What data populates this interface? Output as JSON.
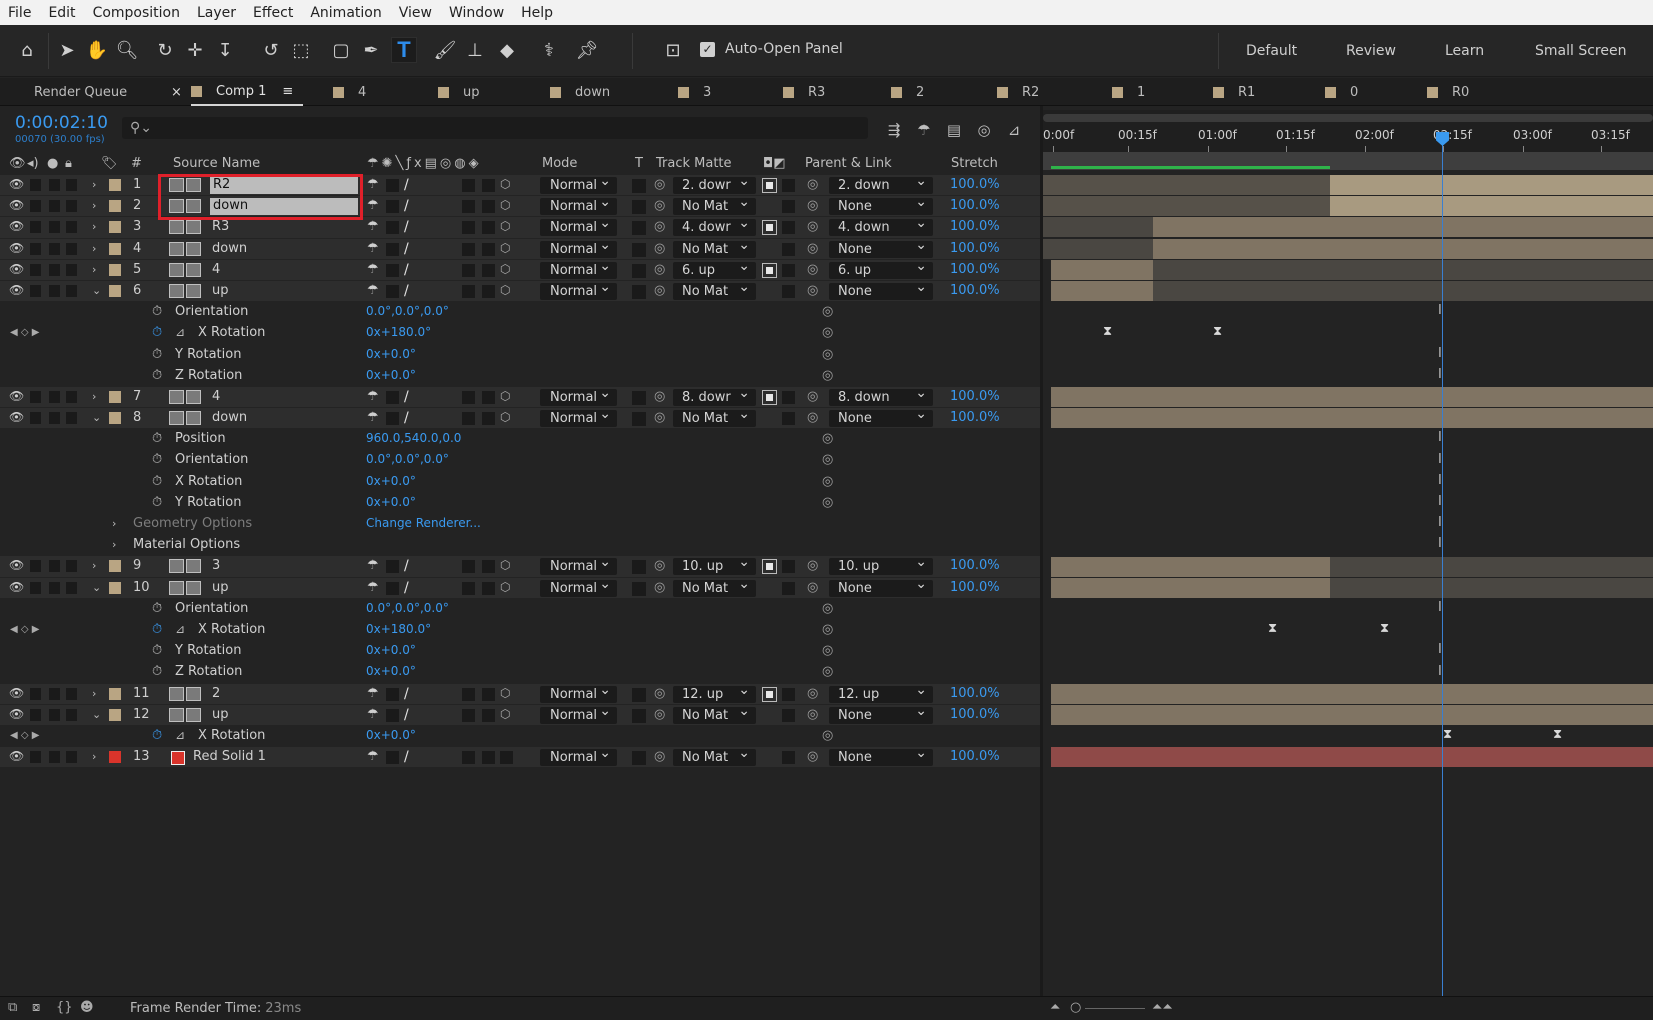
{
  "menu": [
    "File",
    "Edit",
    "Composition",
    "Layer",
    "Effect",
    "Animation",
    "View",
    "Window",
    "Help"
  ],
  "toolbar": {
    "auto_open_label": "Auto-Open Panel",
    "workspaces": [
      "Default",
      "Review",
      "Learn",
      "Small Screen"
    ]
  },
  "tabs": [
    "Render Queue",
    "Comp 1",
    "4",
    "up",
    "down",
    "3",
    "R3",
    "2",
    "R2",
    "1",
    "R1",
    "0",
    "R0"
  ],
  "timecode": "0:00:02:10",
  "frames": "00070 (30.00 fps)",
  "columns": {
    "num": "#",
    "source": "Source Name",
    "mode": "Mode",
    "t": "T",
    "track_matte": "Track Matte",
    "parent": "Parent & Link",
    "stretch": "Stretch"
  },
  "ruler_ticks": [
    "0:00f",
    "00:15f",
    "01:00f",
    "01:15f",
    "02:00f",
    "02:15f",
    "03:00f",
    "03:15f"
  ],
  "layers": [
    {
      "kind": "layer",
      "num": "1",
      "name": "R2",
      "expanded": false,
      "mode": "Normal",
      "matte": "2. dowr",
      "parent": "2. down",
      "stretch": "100.0%",
      "mattesq": true
    },
    {
      "kind": "layer",
      "num": "2",
      "name": "down",
      "expanded": false,
      "mode": "Normal",
      "matte": "No Mat",
      "parent": "None",
      "stretch": "100.0%",
      "mattesq": false
    },
    {
      "kind": "layer",
      "num": "3",
      "name": "R3",
      "expanded": false,
      "mode": "Normal",
      "matte": "4. dowr",
      "parent": "4. down",
      "stretch": "100.0%",
      "mattesq": true
    },
    {
      "kind": "layer",
      "num": "4",
      "name": "down",
      "expanded": false,
      "mode": "Normal",
      "matte": "No Mat",
      "parent": "None",
      "stretch": "100.0%",
      "mattesq": false
    },
    {
      "kind": "layer",
      "num": "5",
      "name": "4",
      "expanded": false,
      "mode": "Normal",
      "matte": "6. up",
      "parent": "6. up",
      "stretch": "100.0%",
      "mattesq": true
    },
    {
      "kind": "layer",
      "num": "6",
      "name": "up",
      "expanded": true,
      "mode": "Normal",
      "matte": "No Mat",
      "parent": "None",
      "stretch": "100.0%",
      "mattesq": false
    },
    {
      "kind": "prop",
      "name": "Orientation",
      "value": "0.0°,0.0°,0.0°",
      "active": false
    },
    {
      "kind": "prop",
      "name": "X Rotation",
      "value": "0x+180.0°",
      "active": true
    },
    {
      "kind": "prop",
      "name": "Y Rotation",
      "value": "0x+0.0°",
      "active": false
    },
    {
      "kind": "prop",
      "name": "Z Rotation",
      "value": "0x+0.0°",
      "active": false
    },
    {
      "kind": "layer",
      "num": "7",
      "name": "4",
      "expanded": false,
      "mode": "Normal",
      "matte": "8. dowr",
      "parent": "8. down",
      "stretch": "100.0%",
      "mattesq": true
    },
    {
      "kind": "layer",
      "num": "8",
      "name": "down",
      "expanded": true,
      "mode": "Normal",
      "matte": "No Mat",
      "parent": "None",
      "stretch": "100.0%",
      "mattesq": false
    },
    {
      "kind": "prop",
      "name": "Position",
      "value": "960.0,540.0,0.0",
      "active": false
    },
    {
      "kind": "prop",
      "name": "Orientation",
      "value": "0.0°,0.0°,0.0°",
      "active": false
    },
    {
      "kind": "prop",
      "name": "X Rotation",
      "value": "0x+0.0°",
      "active": false
    },
    {
      "kind": "prop",
      "name": "Y Rotation",
      "value": "0x+0.0°",
      "active": false
    },
    {
      "kind": "group",
      "name": "Geometry Options",
      "value": "Change Renderer...",
      "dim": true
    },
    {
      "kind": "group",
      "name": "Material Options",
      "value": "",
      "dim": false
    },
    {
      "kind": "layer",
      "num": "9",
      "name": "3",
      "expanded": false,
      "mode": "Normal",
      "matte": "10. up",
      "parent": "10. up",
      "stretch": "100.0%",
      "mattesq": true
    },
    {
      "kind": "layer",
      "num": "10",
      "name": "up",
      "expanded": true,
      "mode": "Normal",
      "matte": "No Mat",
      "parent": "None",
      "stretch": "100.0%",
      "mattesq": false
    },
    {
      "kind": "prop",
      "name": "Orientation",
      "value": "0.0°,0.0°,0.0°",
      "active": false
    },
    {
      "kind": "prop",
      "name": "X Rotation",
      "value": "0x+180.0°",
      "active": true
    },
    {
      "kind": "prop",
      "name": "Y Rotation",
      "value": "0x+0.0°",
      "active": false
    },
    {
      "kind": "prop",
      "name": "Z Rotation",
      "value": "0x+0.0°",
      "active": false
    },
    {
      "kind": "layer",
      "num": "11",
      "name": "2",
      "expanded": false,
      "mode": "Normal",
      "matte": "12. up",
      "parent": "12. up",
      "stretch": "100.0%",
      "mattesq": true
    },
    {
      "kind": "layer",
      "num": "12",
      "name": "up",
      "expanded": true,
      "mode": "Normal",
      "matte": "No Mat",
      "parent": "None",
      "stretch": "100.0%",
      "mattesq": false
    },
    {
      "kind": "prop",
      "name": "X Rotation",
      "value": "0x+0.0°",
      "active": true
    },
    {
      "kind": "layer",
      "num": "13",
      "name": "Red Solid 1",
      "expanded": false,
      "mode": "Normal",
      "matte": "No Mat",
      "parent": "None",
      "stretch": "100.0%",
      "mattesq": false,
      "solid": true
    }
  ],
  "status": {
    "label": "Frame Render Time:",
    "value": "23ms"
  },
  "colors": {
    "accent": "#3a9af0",
    "label_tan": "#b9a583",
    "solid_red": "#d9342b",
    "highlight": "#e0202a"
  }
}
